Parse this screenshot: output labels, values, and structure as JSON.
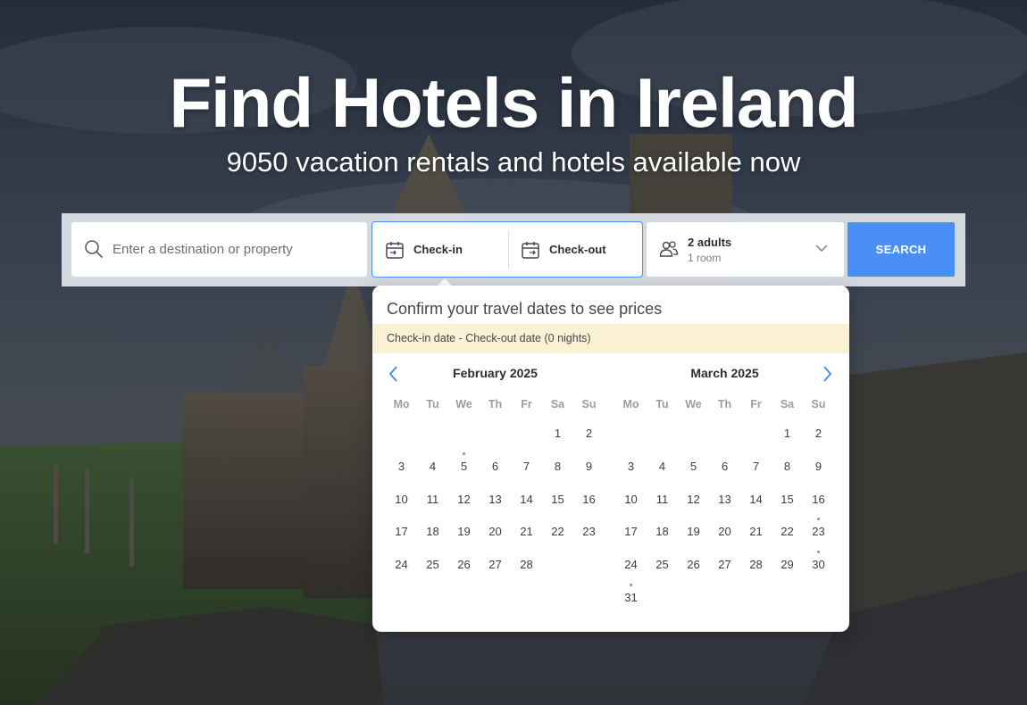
{
  "hero": {
    "title": "Find Hotels in Ireland",
    "subtitle": "9050 vacation rentals and hotels available now"
  },
  "search": {
    "destination_placeholder": "Enter a destination or property",
    "checkin_label": "Check-in",
    "checkout_label": "Check-out",
    "guests_main": "2 adults",
    "guests_sub": "1 room",
    "button_label": "SEARCH"
  },
  "colors": {
    "accent": "#4a8ff5",
    "banner_bg": "#faf0d3"
  },
  "datepicker": {
    "title": "Confirm your travel dates to see prices",
    "banner": "Check-in date - Check-out date (0 nights)",
    "weekdays": [
      "Mo",
      "Tu",
      "We",
      "Th",
      "Fr",
      "Sa",
      "Su"
    ],
    "months": [
      {
        "title": "February 2025",
        "first_weekday_index": 5,
        "num_days": 28,
        "dotted_days": [
          5
        ]
      },
      {
        "title": "March 2025",
        "first_weekday_index": 5,
        "num_days": 31,
        "dotted_days": [
          23,
          30,
          31
        ]
      }
    ]
  }
}
